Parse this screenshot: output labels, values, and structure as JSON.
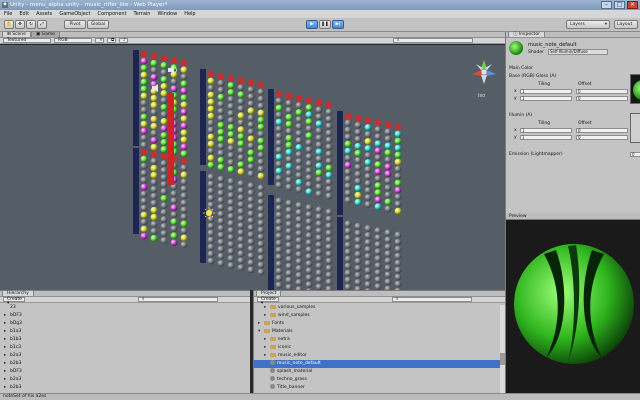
{
  "window": {
    "title": "Unity - menu_alpha.unity - music_riffer_lite - Web Player*",
    "icon": "unity-logo-icon"
  },
  "menu": [
    "File",
    "Edit",
    "Assets",
    "GameObject",
    "Component",
    "Terrain",
    "Window",
    "Help"
  ],
  "toolbar": {
    "pivot_label": "Pivot",
    "global_label": "Global",
    "layers_label": "Layers",
    "layout_label": "Layout"
  },
  "scene_panel": {
    "tabs": [
      "Scene",
      "Game"
    ],
    "shading": "Textured",
    "render_mode": "RGB",
    "persp_label": "Iso"
  },
  "inspector": {
    "tab": "Inspector",
    "material_name": "music_note_default",
    "shader_label": "Shader",
    "shader_value": "Self-Illumin/Diffuse",
    "main_color_label": "Main Color",
    "base_label": "Base (RGB) Gloss (A)",
    "illum_label": "Illumin (A)",
    "tiling_label": "Tiling",
    "offset_label": "Offset",
    "x_label": "x",
    "y_label": "y",
    "one": "1",
    "zero": "0",
    "emission_label": "Emission (Lightmapper)",
    "emission_value": "0",
    "preview_label": "Preview"
  },
  "hierarchy": {
    "tab": "Hierarchy",
    "create_label": "Create",
    "items": [
      "23",
      "bDF3",
      "bDg3",
      "b1a3",
      "b1b3",
      "b1c3",
      "b2a3",
      "b2b3",
      "bDF3",
      "b2a3",
      "b2b3"
    ]
  },
  "project": {
    "tab": "Project",
    "create_label": "Create",
    "items": [
      {
        "label": "various_samples",
        "kind": "folder",
        "depth": 1,
        "open": false
      },
      {
        "label": "wind_samples",
        "kind": "folder",
        "depth": 1,
        "open": false
      },
      {
        "label": "Fonts",
        "kind": "folder",
        "depth": 0,
        "open": false
      },
      {
        "label": "Materials",
        "kind": "folder",
        "depth": 0,
        "open": true
      },
      {
        "label": "extra",
        "kind": "folder",
        "depth": 1,
        "open": false
      },
      {
        "label": "iconic",
        "kind": "folder",
        "depth": 1,
        "open": false
      },
      {
        "label": "music_editor",
        "kind": "folder",
        "depth": 1,
        "open": false
      },
      {
        "label": "music_note_default",
        "kind": "material",
        "depth": 1,
        "selected": true
      },
      {
        "label": "splash_material",
        "kind": "material",
        "depth": 1
      },
      {
        "label": "techno_grass",
        "kind": "material",
        "depth": 1
      },
      {
        "label": "Title_banner",
        "kind": "material",
        "depth": 1
      }
    ]
  },
  "status_text": "noteSet of his a2es",
  "colors": {
    "play_blue": "#4d86d3",
    "selection_blue": "#3f72c6",
    "scene_bg": "#555d66",
    "note_green": "#3fd24a",
    "note_red": "#d02424",
    "bar_navy": "#1d2650"
  }
}
